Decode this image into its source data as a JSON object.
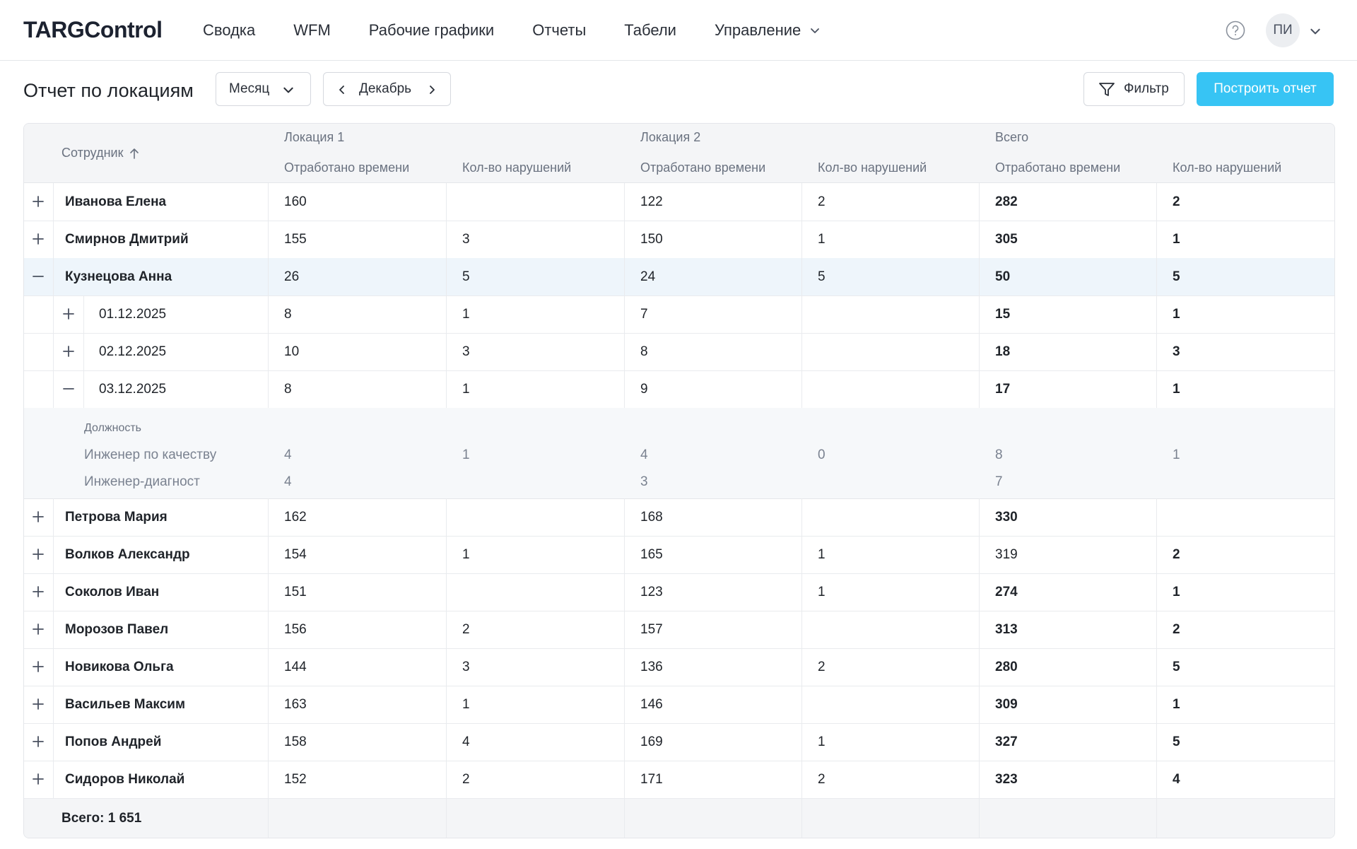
{
  "app": {
    "logo": "TARGControl"
  },
  "nav": {
    "items": [
      "Сводка",
      "WFM",
      "Рабочие графики",
      "Отчеты",
      "Табели",
      "Управление"
    ]
  },
  "user": {
    "initials": "ПИ"
  },
  "page": {
    "title": "Отчет по локациям",
    "period_type": "Месяц",
    "period_value": "Декабрь",
    "filter_label": "Фильтр",
    "build_label": "Построить отчет"
  },
  "table": {
    "employee_header": "Сотрудник",
    "groups": [
      "Локация 1",
      "Локация 2",
      "Всего"
    ],
    "subheaders": [
      "Отработано времени",
      "Кол-во нарушений",
      "Отработано времени",
      "Кол-во нарушений",
      "Отработано времени",
      "Кол-во нарушений"
    ],
    "rows": [
      {
        "name": "Иванова Елена",
        "vals": [
          "160",
          "",
          "122",
          "2",
          "282",
          "2"
        ],
        "total_bold": true
      },
      {
        "name": "Смирнов Дмитрий",
        "vals": [
          "155",
          "3",
          "150",
          "1",
          "305",
          "1"
        ],
        "total_bold": true
      },
      {
        "name": "Кузнецова Анна",
        "vals": [
          "26",
          "5",
          "24",
          "5",
          "50",
          "5"
        ],
        "total_bold": true,
        "expanded": true
      },
      {
        "name": "01.12.2025",
        "vals": [
          "8",
          "1",
          "7",
          "",
          "15",
          "1"
        ],
        "total_bold": true,
        "child": true
      },
      {
        "name": "02.12.2025",
        "vals": [
          "10",
          "3",
          "8",
          "",
          "18",
          "3"
        ],
        "total_bold": true,
        "child": true
      },
      {
        "name": "03.12.2025",
        "vals": [
          "8",
          "1",
          "9",
          "",
          "17",
          "1"
        ],
        "total_bold": true,
        "child": true,
        "expanded": true
      },
      {
        "name": "Петрова Мария",
        "vals": [
          "162",
          "",
          "168",
          "",
          "330",
          ""
        ],
        "total_bold": true
      },
      {
        "name": "Волков Александр",
        "vals": [
          "154",
          "1",
          "165",
          "1",
          "319",
          "2"
        ],
        "total_bold": false
      },
      {
        "name": "Соколов Иван",
        "vals": [
          "151",
          "",
          "123",
          "1",
          "274",
          "1"
        ],
        "total_bold": true
      },
      {
        "name": "Морозов Павел",
        "vals": [
          "156",
          "2",
          "157",
          "",
          "313",
          "2"
        ],
        "total_bold": true
      },
      {
        "name": "Новикова Ольга",
        "vals": [
          "144",
          "3",
          "136",
          "2",
          "280",
          "5"
        ],
        "total_bold": true
      },
      {
        "name": "Васильев Максим",
        "vals": [
          "163",
          "1",
          "146",
          "",
          "309",
          "1"
        ],
        "total_bold": true
      },
      {
        "name": "Попов Андрей",
        "vals": [
          "158",
          "4",
          "169",
          "1",
          "327",
          "5"
        ],
        "total_bold": true
      },
      {
        "name": "Сидоров Николай",
        "vals": [
          "152",
          "2",
          "171",
          "2",
          "323",
          "4"
        ],
        "total_bold": true
      }
    ],
    "detail": {
      "label": "Должность",
      "rows": [
        {
          "name": "Инженер по качеству",
          "vals": [
            "4",
            "1",
            "4",
            "0",
            "8",
            "1"
          ]
        },
        {
          "name": "Инженер-диагност",
          "vals": [
            "4",
            "",
            "3",
            "",
            "7",
            ""
          ]
        }
      ]
    },
    "footer": {
      "label": "Всего:",
      "value": "1 651"
    }
  }
}
